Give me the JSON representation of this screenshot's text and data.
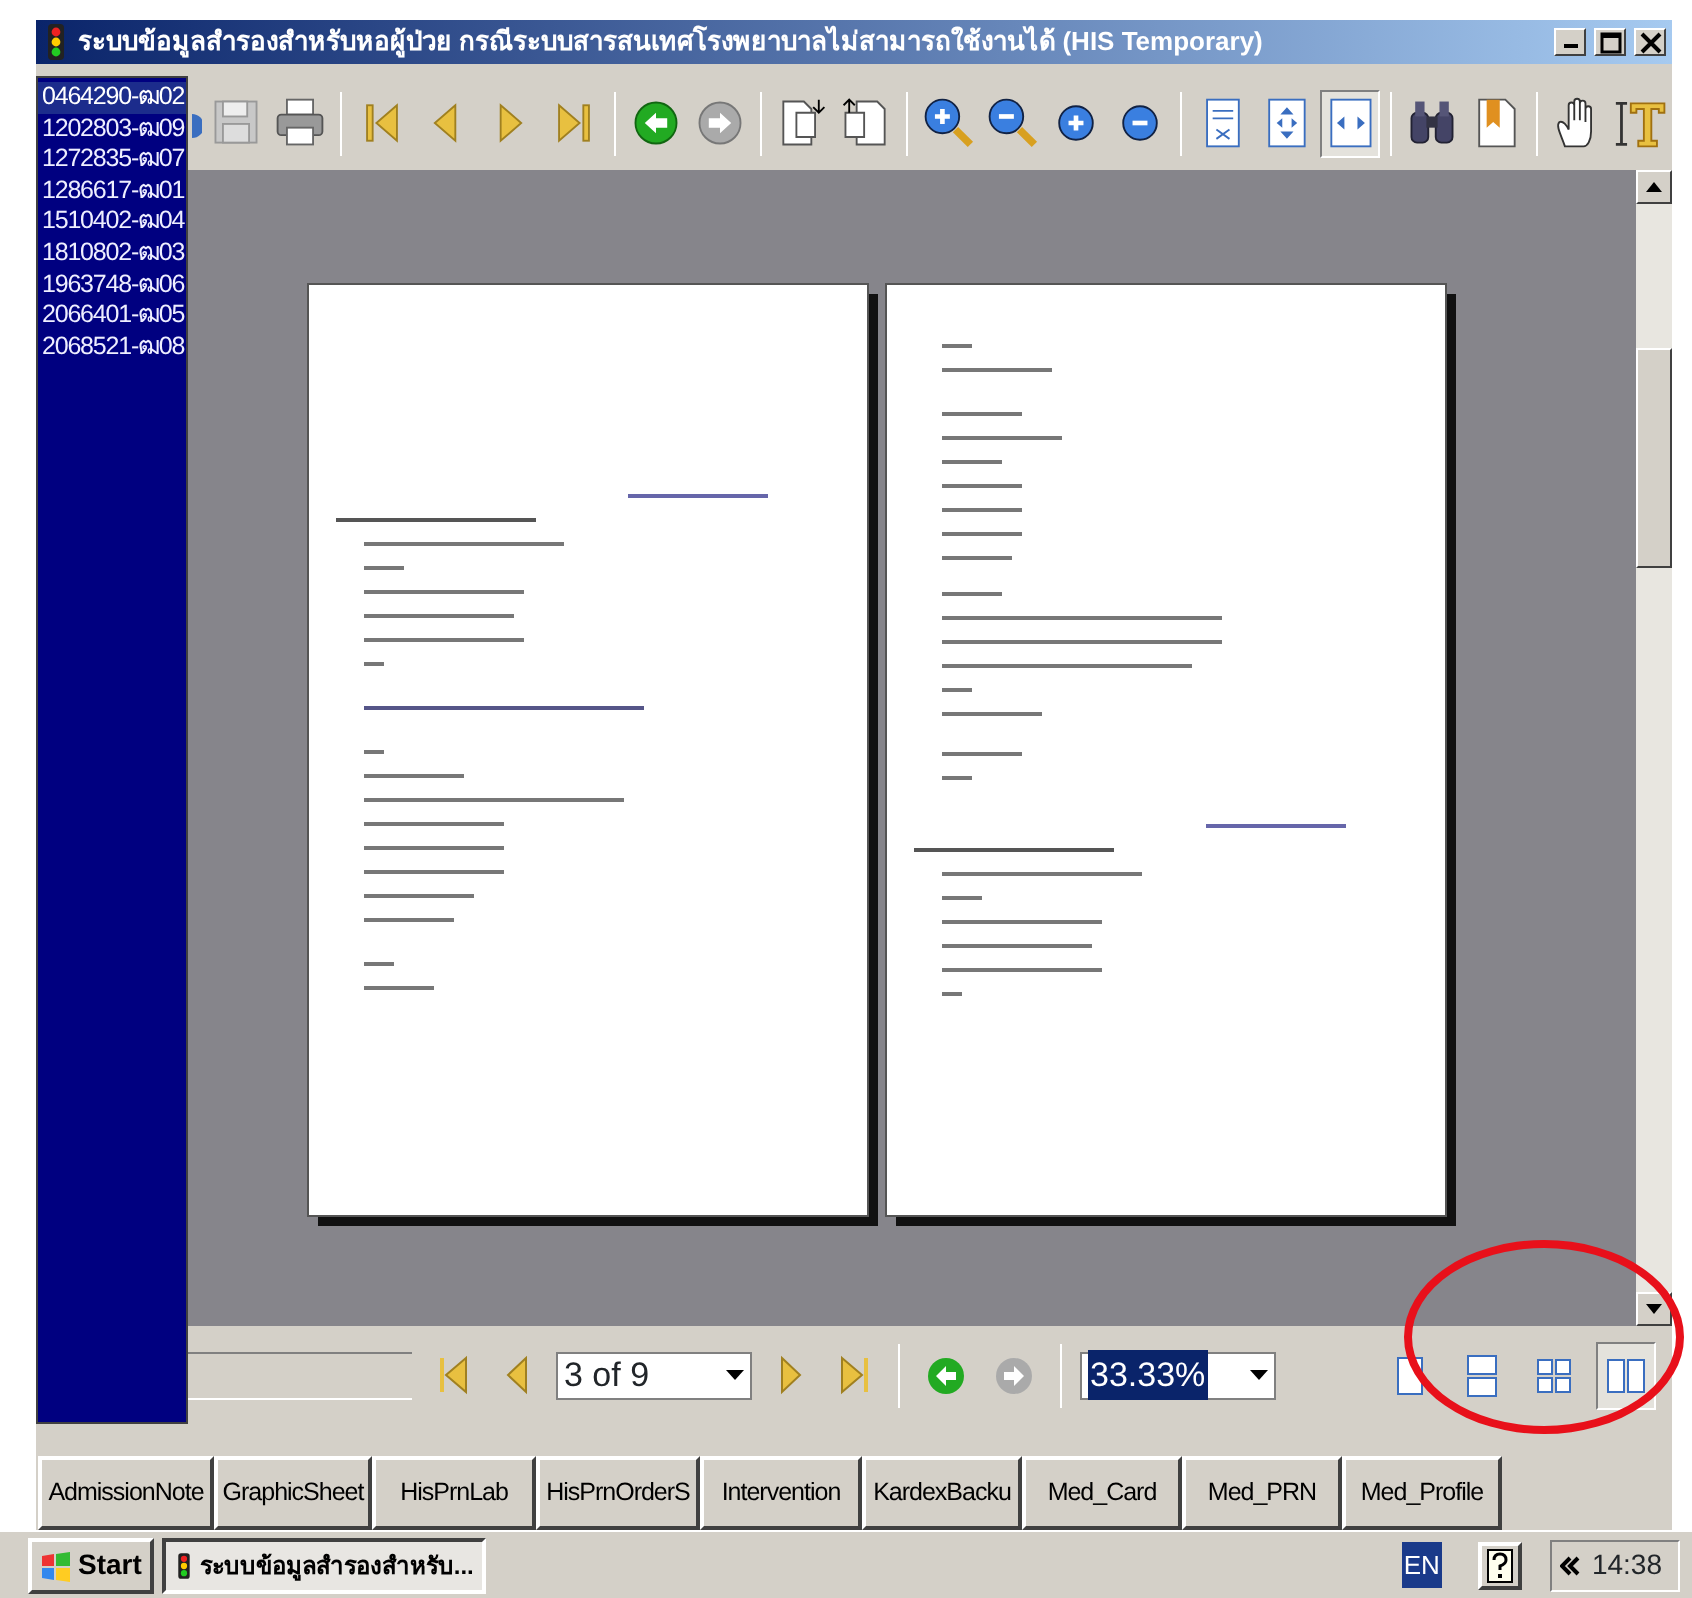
{
  "window": {
    "title": "ระบบข้อมูลสำรองสำหรับหอผู้ป่วย กรณีระบบสารสนเทศโรงพยาบาลไม่สามารถใช้งานได้ (HIS Temporary)"
  },
  "record_list": [
    {
      "label": "0464290-ฒ02",
      "selected": true
    },
    {
      "label": "1202803-ฒ09",
      "selected": false
    },
    {
      "label": "1272835-ฒ07",
      "selected": false
    },
    {
      "label": "1286617-ฒ01",
      "selected": false
    },
    {
      "label": "1510402-ฒ04",
      "selected": false
    },
    {
      "label": "1810802-ฒ03",
      "selected": false
    },
    {
      "label": "1963748-ฒ06",
      "selected": false
    },
    {
      "label": "2066401-ฒ05",
      "selected": false
    },
    {
      "label": "2068521-ฒ08",
      "selected": false
    }
  ],
  "toolbar": {
    "zoom_modes": [
      {
        "kind": "actual-size",
        "selected": false
      },
      {
        "kind": "fit-page",
        "selected": false
      },
      {
        "kind": "fit-width",
        "selected": true
      }
    ]
  },
  "navigator": {
    "page": "3 of 9",
    "zoom": "33.33%",
    "views": [
      {
        "kind": "single",
        "selected": false
      },
      {
        "kind": "continuous",
        "selected": false
      },
      {
        "kind": "multiple",
        "selected": false
      },
      {
        "kind": "facing",
        "selected": true
      }
    ]
  },
  "tabs": [
    {
      "label": "AdmissionNote"
    },
    {
      "label": "GraphicSheet"
    },
    {
      "label": "HisPrnLab"
    },
    {
      "label": "HisPrnOrderS"
    },
    {
      "label": "Intervention"
    },
    {
      "label": "KardexBacku"
    },
    {
      "label": "Med_Card"
    },
    {
      "label": "Med_PRN"
    },
    {
      "label": "Med_Profile"
    }
  ],
  "taskbar": {
    "start": "Start",
    "task": "ระบบข้อมูลสำรองสำหรับ...",
    "language": "EN",
    "clock": "14:38"
  }
}
